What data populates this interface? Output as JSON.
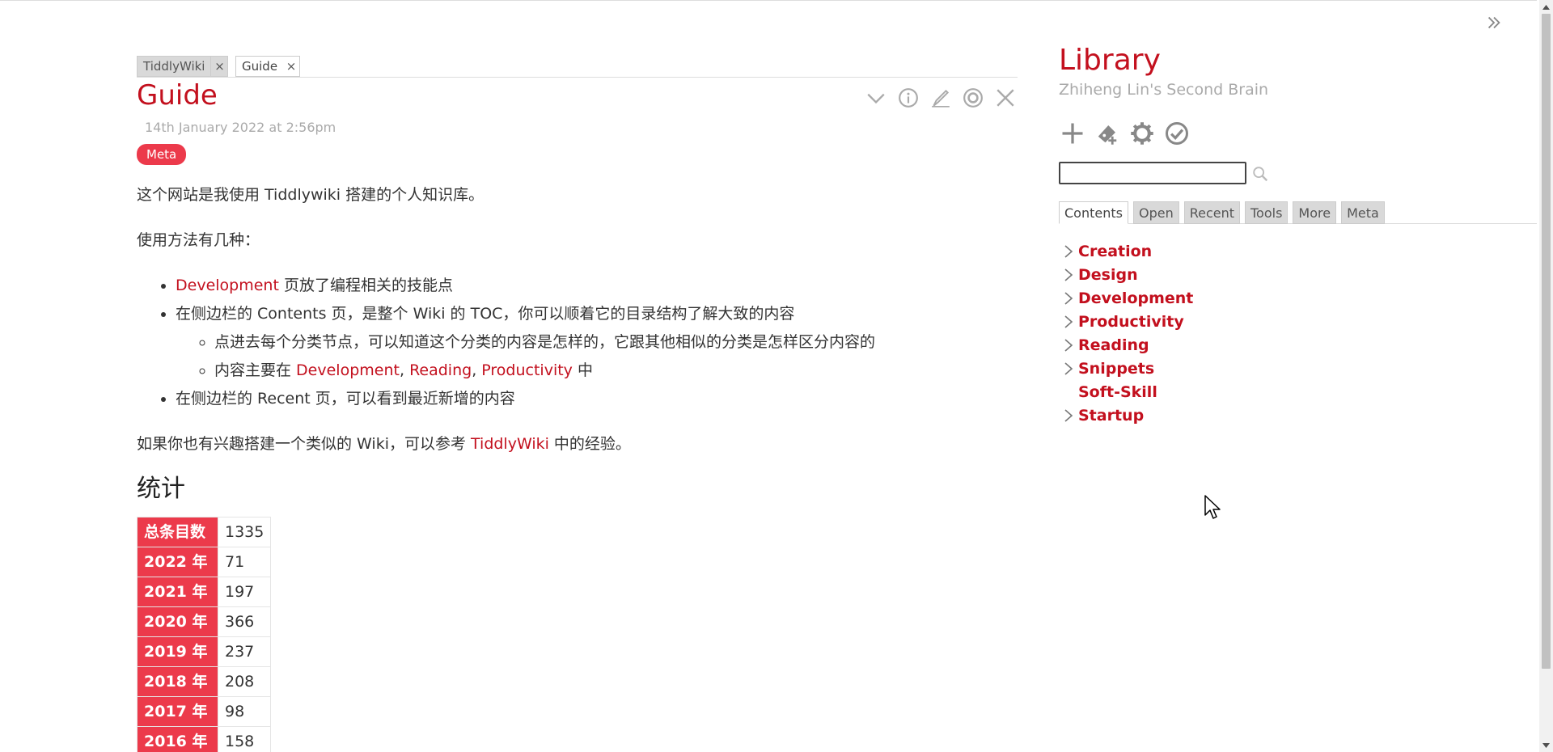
{
  "story_tabs": [
    {
      "label": "TiddlyWiki",
      "close": "×"
    },
    {
      "label": "Guide",
      "close": "×"
    }
  ],
  "tiddler": {
    "title": "Guide",
    "subtitle": "14th January 2022 at 2:56pm",
    "tag": "Meta",
    "toolbar_icons": [
      "chevron-down-icon",
      "info-icon",
      "edit-icon",
      "target-icon",
      "close-icon"
    ],
    "body": {
      "p1": "这个网站是我使用 Tiddlywiki 搭建的个人知识库。",
      "p2": "使用方法有几种：",
      "li1_link": "Development",
      "li1_text": " 页放了编程相关的技能点",
      "li2_text": "在侧边栏的 Contents 页，是整个 Wiki 的 TOC，你可以顺着它的目录结构了解大致的内容",
      "li2_sub1": "点进去每个分类节点，可以知道这个分类的内容是怎样的，它跟其他相似的分类是怎样区分内容的",
      "li2_sub2_prefix": "内容主要在 ",
      "li2_sub2_link1": "Development",
      "li2_sub2_sep1": ", ",
      "li2_sub2_link2": "Reading",
      "li2_sub2_sep2": ", ",
      "li2_sub2_link3": "Productivity",
      "li2_sub2_suffix": " 中",
      "li3_text": "在侧边栏的 Recent 页，可以看到最近新增的内容",
      "p3_prefix": "如果你也有兴趣搭建一个类似的 Wiki，可以参考 ",
      "p3_link": "TiddlyWiki",
      "p3_suffix": " 中的经验。"
    },
    "stats_heading": "统计",
    "stats": [
      {
        "key": "总条目数",
        "value": "1335"
      },
      {
        "key": "2022 年",
        "value": "71"
      },
      {
        "key": "2021 年",
        "value": "197"
      },
      {
        "key": "2020 年",
        "value": "366"
      },
      {
        "key": "2019 年",
        "value": "237"
      },
      {
        "key": "2018 年",
        "value": "208"
      },
      {
        "key": "2017 年",
        "value": "98"
      },
      {
        "key": "2016 年",
        "value": "158"
      }
    ]
  },
  "sidebar": {
    "site_title": "Library",
    "site_subtitle": "Zhiheng Lin's Second Brain",
    "page_controls": [
      "plus-icon",
      "new-journal-icon",
      "gear-icon",
      "check-circle-icon"
    ],
    "search_placeholder": "",
    "tabs": [
      "Contents",
      "Open",
      "Recent",
      "Tools",
      "More",
      "Meta"
    ],
    "active_tab": "Contents",
    "toc": [
      {
        "label": "Creation",
        "expandable": true
      },
      {
        "label": "Design",
        "expandable": true
      },
      {
        "label": "Development",
        "expandable": true
      },
      {
        "label": "Productivity",
        "expandable": true
      },
      {
        "label": "Reading",
        "expandable": true
      },
      {
        "label": "Snippets",
        "expandable": true
      },
      {
        "label": "Soft-Skill",
        "expandable": false
      },
      {
        "label": "Startup",
        "expandable": true
      }
    ]
  },
  "colors": {
    "accent": "#c3101e",
    "tag": "#ec3a4b",
    "subtitle": "#aaaaaa",
    "icon": "#aaaaaa",
    "tab_inactive": "#d9d9d9"
  }
}
